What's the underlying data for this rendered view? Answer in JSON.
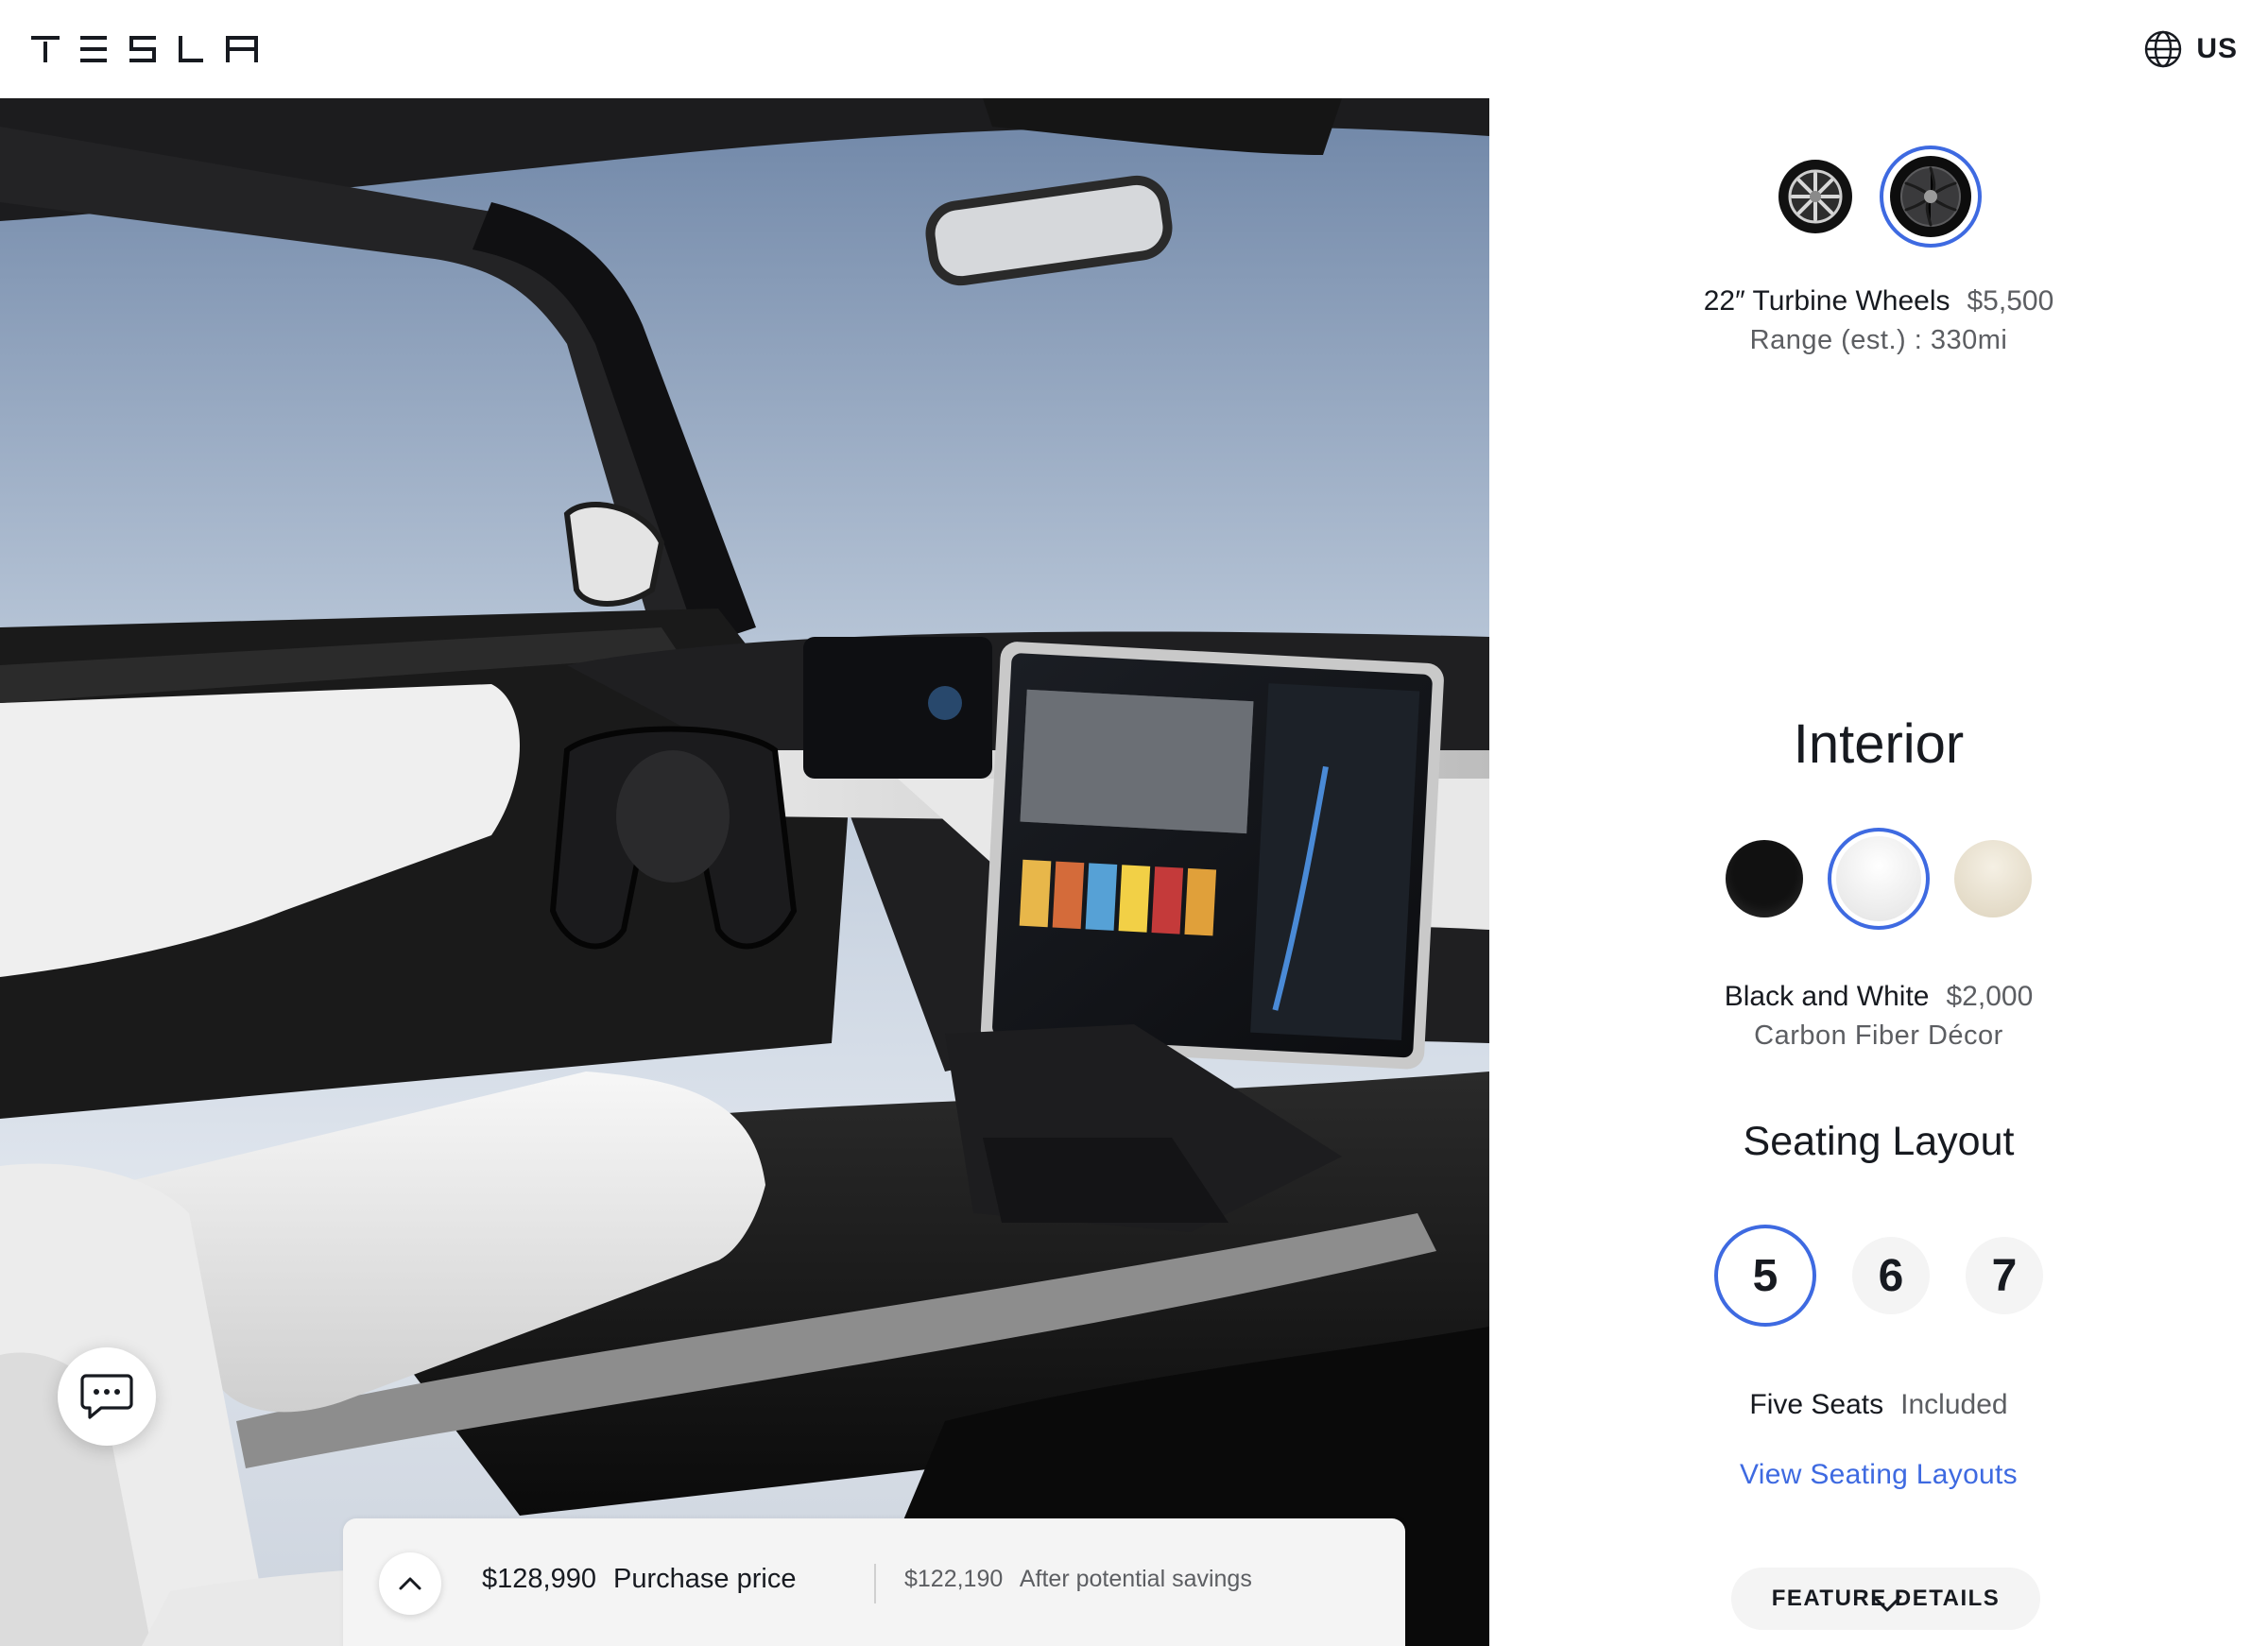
{
  "header": {
    "brand": "TESLA",
    "locale_label": "US",
    "locale_icon": "globe-icon"
  },
  "wheels": {
    "options": [
      {
        "id": "19-gemini",
        "icon": "wheel-icon",
        "selected": false
      },
      {
        "id": "22-turbine",
        "icon": "wheel-icon",
        "selected": true
      }
    ],
    "selected_name": "22″ Turbine Wheels",
    "selected_price": "$5,500",
    "range": "Range (est.) : 330mi"
  },
  "interior": {
    "title": "Interior",
    "swatches": [
      {
        "id": "black",
        "color": "#111111",
        "selected": false
      },
      {
        "id": "black-white",
        "color": "#f3f3f3",
        "selected": true
      },
      {
        "id": "cream",
        "color": "#ece4d2",
        "selected": false
      }
    ],
    "selected_name": "Black and White",
    "selected_price": "$2,000",
    "decor": "Carbon Fiber Décor"
  },
  "seating": {
    "title": "Seating Layout",
    "options": [
      {
        "label": "5",
        "selected": true
      },
      {
        "label": "6",
        "selected": false
      },
      {
        "label": "7",
        "selected": false
      }
    ],
    "selected_name": "Five Seats",
    "selected_price": "Included",
    "link_label": "View Seating Layouts"
  },
  "feature_details": {
    "label": "FEATURE DETAILS",
    "icon": "chevron-down-icon"
  },
  "price_bar": {
    "toggle_icon": "chevron-up-icon",
    "purchase_amount": "$128,990",
    "purchase_label": "Purchase price",
    "savings_amount": "$122,190",
    "savings_label": "After potential savings"
  },
  "chat": {
    "icon": "chat-bubble-icon"
  },
  "colors": {
    "accent": "#3e6ae1",
    "text": "#171a20",
    "muted": "#5c5e62",
    "surface": "#f4f4f4"
  }
}
